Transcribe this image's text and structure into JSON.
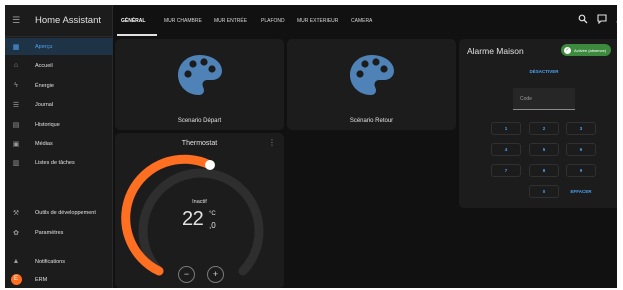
{
  "app": {
    "title": "Home Assistant"
  },
  "sidebar": {
    "items": [
      {
        "label": "Aperçu",
        "icon": "view-dashboard-icon",
        "glyph": "▦",
        "active": true
      },
      {
        "label": "Accueil",
        "icon": "home-icon",
        "glyph": "⌂"
      },
      {
        "label": "Énergie",
        "icon": "lightning-bolt-icon",
        "glyph": "ϟ"
      },
      {
        "label": "Journal",
        "icon": "format-list-icon",
        "glyph": "☰"
      },
      {
        "label": "Historique",
        "icon": "chart-box-icon",
        "glyph": "▤"
      },
      {
        "label": "Médias",
        "icon": "play-box-multiple-icon",
        "glyph": "▣"
      },
      {
        "label": "Listes de tâches",
        "icon": "clipboard-list-icon",
        "glyph": "▥"
      }
    ],
    "bottom_items": [
      {
        "label": "Outils de développement",
        "icon": "hammer-icon",
        "glyph": "⚒"
      },
      {
        "label": "Paramètres",
        "icon": "cog-icon",
        "glyph": "✿"
      },
      {
        "label": "Notifications",
        "icon": "bell-icon",
        "glyph": "▲"
      },
      {
        "label": "ERM",
        "avatar": "E"
      }
    ]
  },
  "header": {
    "tabs": [
      "GÉNÉRAL",
      "MUR CHAMBRE",
      "MUR ENTRÉE",
      "PLAFOND",
      "MUR EXTERIEUR",
      "CAMERA"
    ],
    "active_tab": "GÉNÉRAL"
  },
  "scenes": [
    {
      "label": "Scenario Départ",
      "icon": "palette-icon"
    },
    {
      "label": "Scénario Retour",
      "icon": "palette-icon"
    }
  ],
  "thermostat": {
    "title": "Thermostat",
    "state": "Inactif",
    "temp_int": "22",
    "temp_dec": ",0",
    "unit": "°C",
    "minus": "−",
    "plus": "+",
    "accent": "#ff6f22"
  },
  "alarm": {
    "title": "Alarme Maison",
    "badge": "Activée (absence)",
    "disarm_label": "DÉSACTIVER",
    "code_placeholder": "Code",
    "keys": [
      "1",
      "2",
      "3",
      "4",
      "5",
      "6",
      "7",
      "8",
      "9",
      "0"
    ],
    "clear_label": "EFFACER"
  },
  "colors": {
    "primary": "#4ea3f1",
    "card": "#1c1c1c",
    "background": "#111111",
    "badge": "#3d8a3f",
    "palette": "#4f83b7"
  }
}
